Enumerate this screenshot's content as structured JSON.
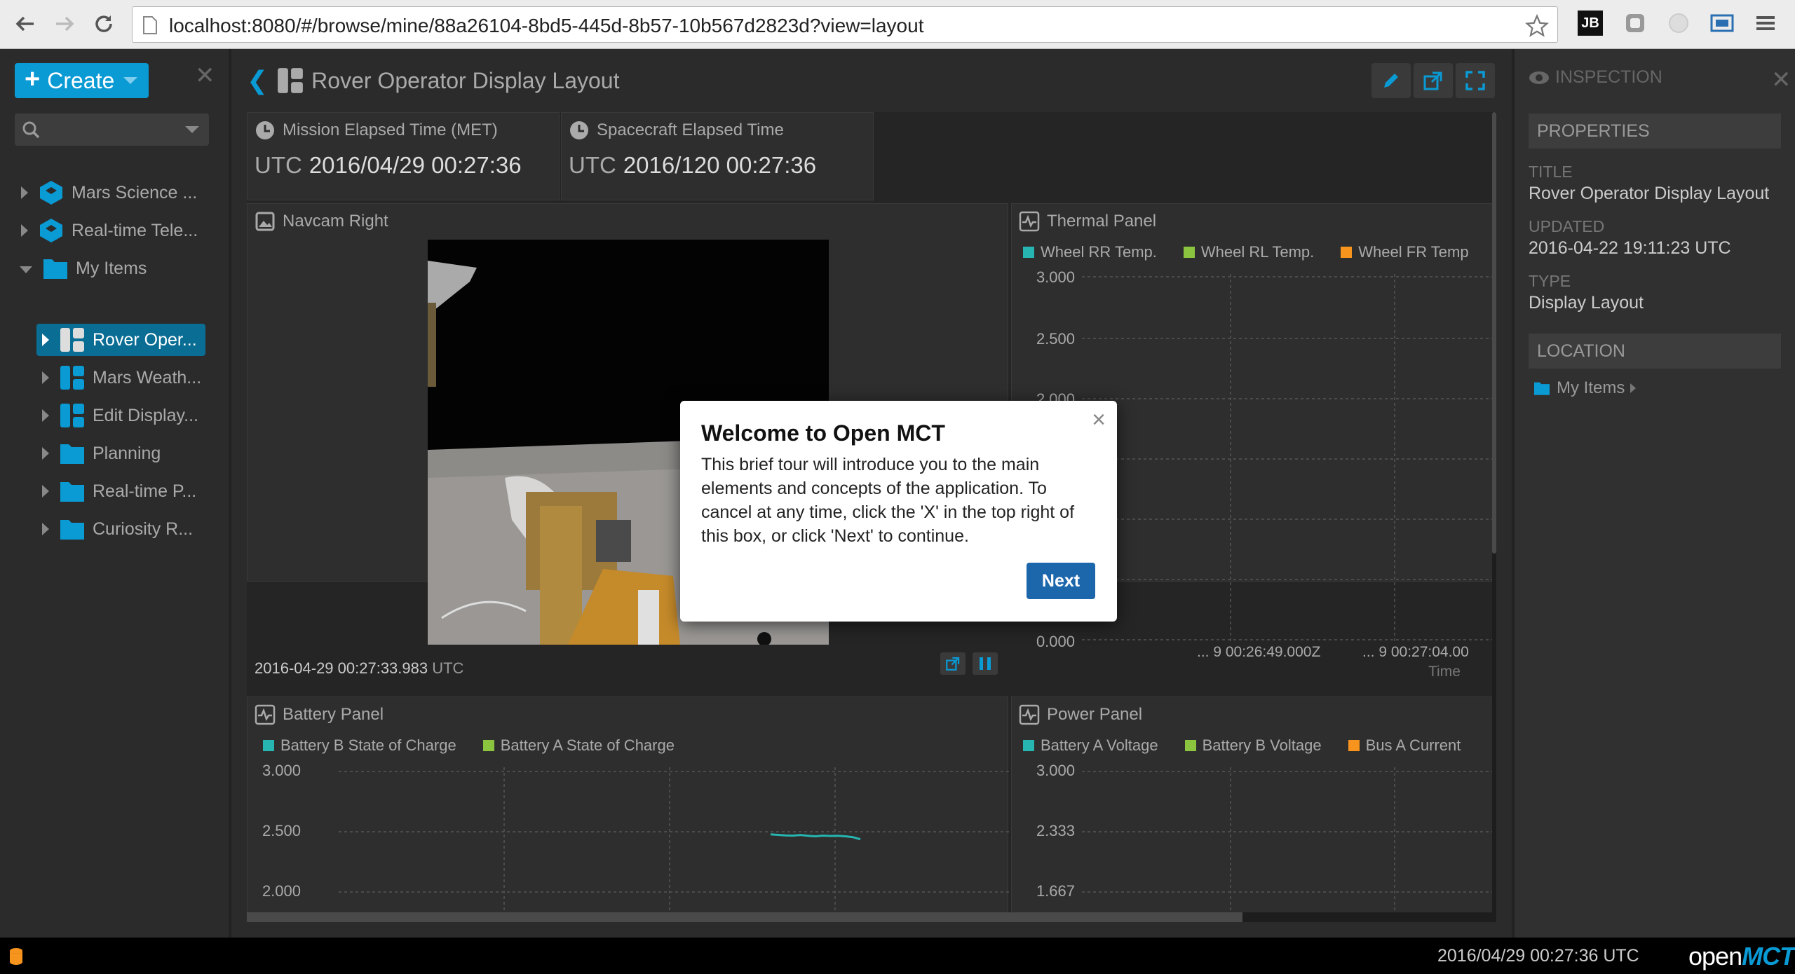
{
  "browser": {
    "url": "localhost:8080/#/browse/mine/88a26104-8bd5-445d-8b57-10b567d2823d?view=layout",
    "extension_label": "JB"
  },
  "left_pane": {
    "create_label": "Create",
    "tree": [
      {
        "label": "Mars Science ...",
        "icon": "telemetry-icon",
        "state": "collapsed"
      },
      {
        "label": "Real-time Tele...",
        "icon": "telemetry-icon",
        "state": "collapsed"
      },
      {
        "label": "My Items",
        "icon": "folder-icon",
        "state": "expanded"
      },
      {
        "label": "Rover Oper...",
        "icon": "layout-icon",
        "state": "collapsed",
        "selected": true
      },
      {
        "label": "Mars Weath...",
        "icon": "layout-icon",
        "state": "collapsed"
      },
      {
        "label": "Edit Display...",
        "icon": "layout-icon",
        "state": "collapsed"
      },
      {
        "label": "Planning",
        "icon": "folder-icon",
        "state": "collapsed"
      },
      {
        "label": "Real-time P...",
        "icon": "folder-icon",
        "state": "collapsed"
      },
      {
        "label": "Curiosity R...",
        "icon": "folder-icon",
        "state": "collapsed"
      }
    ]
  },
  "main": {
    "title": "Rover Operator Display Layout",
    "clocks": [
      {
        "title": "Mission Elapsed Time (MET)",
        "prefix": "UTC",
        "value": "2016/04/29 00:27:36"
      },
      {
        "title": "Spacecraft Elapsed Time",
        "prefix": "UTC",
        "value": "2016/120 00:27:36"
      }
    ],
    "navcam": {
      "title": "Navcam Right",
      "timestamp": "2016-04-29 00:27:33.983",
      "timestamp_unit": "UTC"
    },
    "thermal": {
      "title": "Thermal Panel",
      "legend": [
        "Wheel RR Temp.",
        "Wheel RL Temp.",
        "Wheel FR Temp"
      ],
      "y_ticks": [
        "3.000",
        "2.500",
        "2.000",
        "0.000"
      ],
      "x_ticks": [
        "... 9 00:26:49.000Z",
        "... 9 00:27:04.00"
      ],
      "x_label": "Time"
    },
    "battery": {
      "title": "Battery Panel",
      "legend": [
        "Battery B State of Charge",
        "Battery A State of Charge"
      ],
      "y_ticks": [
        "3.000",
        "2.500",
        "2.000"
      ]
    },
    "power": {
      "title": "Power Panel",
      "legend": [
        "Battery A Voltage",
        "Battery B Voltage",
        "Bus A Current"
      ],
      "y_ticks": [
        "3.000",
        "2.333",
        "1.667"
      ]
    }
  },
  "inspector": {
    "header": "INSPECTION",
    "properties_label": "PROPERTIES",
    "title_label": "TITLE",
    "title_value": "Rover Operator Display Layout",
    "updated_label": "UPDATED",
    "updated_value": "2016-04-22 19:11:23 UTC",
    "type_label": "TYPE",
    "type_value": "Display Layout",
    "location_label": "LOCATION",
    "location_value": "My Items"
  },
  "status_bar": {
    "time": "2016/04/29 00:27:36 UTC",
    "brand_a": "open",
    "brand_b": "MCT"
  },
  "dialog": {
    "title": "Welcome to Open MCT",
    "body": "This brief tour will introduce you to the main elements and concepts of the application. To cancel at any time, click the 'X' in the top right of this box, or click 'Next' to continue.",
    "close": "×",
    "next_label": "Next"
  },
  "chart_data": [
    {
      "type": "line",
      "title": "Thermal Panel",
      "series": [
        {
          "name": "Wheel RR Temp.",
          "values": []
        },
        {
          "name": "Wheel RL Temp.",
          "values": []
        },
        {
          "name": "Wheel FR Temp",
          "values": []
        }
      ],
      "x_tick_labels": [
        "... 9 00:26:49.000Z",
        "... 9 00:27:04.00"
      ],
      "xlabel": "Time",
      "y_tick_labels": [
        "3.000",
        "2.500",
        "2.000",
        "0.000"
      ],
      "grid": true
    },
    {
      "type": "line",
      "title": "Battery Panel",
      "series": [
        {
          "name": "Battery B State of Charge",
          "values": [
            2.478,
            2.474,
            2.47,
            2.468,
            2.473,
            2.466,
            2.462,
            2.468,
            2.465,
            2.467,
            2.462,
            2.455,
            2.438
          ]
        },
        {
          "name": "Battery A State of Charge",
          "values": []
        }
      ],
      "y_tick_labels": [
        "3.000",
        "2.500",
        "2.000"
      ],
      "ylim": [
        2.0,
        3.0
      ],
      "grid": true
    },
    {
      "type": "line",
      "title": "Power Panel",
      "series": [
        {
          "name": "Battery A Voltage",
          "values": []
        },
        {
          "name": "Battery B Voltage",
          "values": []
        },
        {
          "name": "Bus A Current",
          "values": []
        }
      ],
      "y_tick_labels": [
        "3.000",
        "2.333",
        "1.667"
      ],
      "grid": true
    }
  ],
  "colors": {
    "accent": "#0a9ad4",
    "selected": "#0a6d94",
    "series_teal": "#26b5b0",
    "series_green": "#8bc53f",
    "series_orange": "#f7941d",
    "dialog_button": "#1c66ac"
  }
}
